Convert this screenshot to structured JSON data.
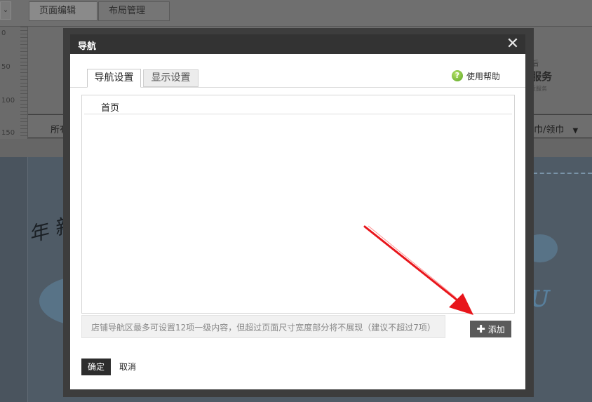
{
  "background": {
    "dropdown_arrow": "⌄",
    "tabs": [
      "页面编辑",
      "布局管理"
    ],
    "ruler_ticks": [
      "0",
      "50",
      "100",
      "150"
    ],
    "header_small": "售后",
    "header_big": "级服务",
    "header_tiny": "品质服务",
    "nav_left": "所有宝",
    "nav_right": "丝巾/领巾",
    "nav_right_arrow": "▼",
    "banner_script": "年 新"
  },
  "modal": {
    "title": "导航",
    "close_glyph": "✕",
    "tabs": [
      {
        "label": "导航设置",
        "active": true
      },
      {
        "label": "显示设置",
        "active": false
      }
    ],
    "help_icon_glyph": "?",
    "help_label": "使用帮助",
    "nav_items": [
      {
        "label": "首页"
      }
    ],
    "info_text": "店铺导航区最多可设置12项一级内容，但超过页面尺寸宽度部分将不展现（建议不超过7项）",
    "add_icon": "plus-icon",
    "add_glyph": "✚",
    "add_label": "添加",
    "confirm_label": "确定",
    "cancel_label": "取消"
  },
  "colors": {
    "titlebar": "#333333",
    "annotation_arrow": "#e8151b",
    "help_icon": "#6ab82d"
  }
}
